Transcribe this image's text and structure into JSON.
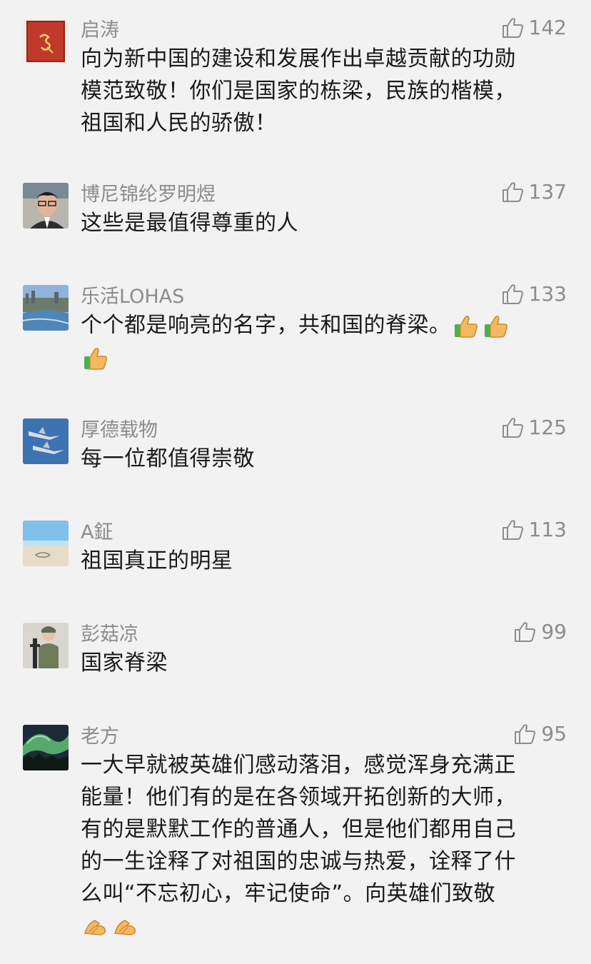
{
  "comments": [
    {
      "name": "启涛",
      "likes": "142",
      "text": "向为新中国的建设和发展作出卓越贡献的功勋\n模范致敬！你们是国家的栋梁，民族的楷模，\n祖国和人民的骄傲！",
      "avatar_color": "#c0392b"
    },
    {
      "name": "博尼锦纶罗明煜",
      "likes": "137",
      "text": "这些是最值得尊重的人"
    },
    {
      "name": "乐活LOHAS",
      "likes": "133",
      "text": "个个都是响亮的名字，共和国的脊梁。"
    },
    {
      "name": "厚德载物",
      "likes": "125",
      "text": "每一位都值得崇敬"
    },
    {
      "name": "A鉦",
      "likes": "113",
      "text": "祖国真正的明星"
    },
    {
      "name": "彭菇凉",
      "likes": "99",
      "text": "国家脊梁"
    },
    {
      "name": "老方",
      "likes": "95",
      "text": "一大早就被英雄们感动落泪，感觉浑身充满正\n能量！他们有的是在各领域开拓创新的大师，\n有的是默默工作的普通人，但是他们都用自己\n的一生诠释了对祖国的忠诚与热爱，诠释了什\n么叫“不忘初心，牢记使命”。向英雄们致敬"
    }
  ],
  "icons": {
    "like": "thumbs-up-outline-icon",
    "emoji_thumbs": "thumbs-up-emoji",
    "emoji_fist": "fist-emoji"
  },
  "colors": {
    "background": "#f2f2f2",
    "meta_text": "#8c8c8c",
    "body_text": "#1a1a1a"
  }
}
